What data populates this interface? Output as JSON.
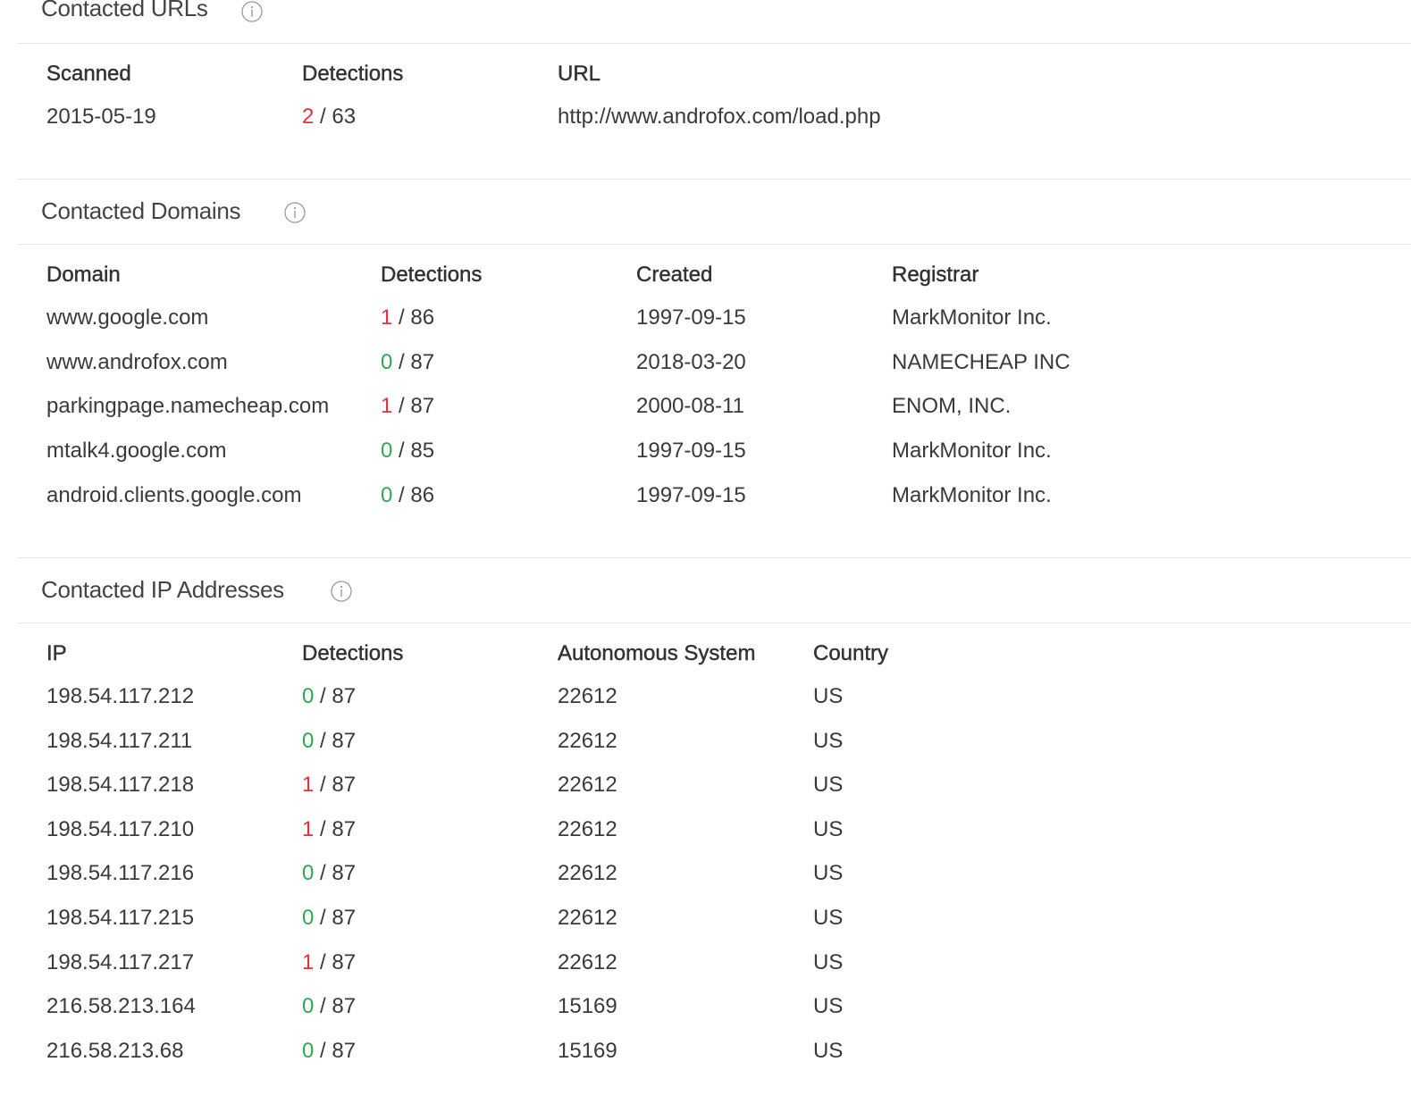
{
  "sections": {
    "urls": {
      "title": "Contacted URLs",
      "headers": [
        "Scanned",
        "Detections",
        "URL"
      ],
      "rows": [
        {
          "scanned": "2015-05-19",
          "det_pos": "2",
          "det_total": "63",
          "url": "http://www.androfox.com/load.php"
        }
      ]
    },
    "domains": {
      "title": "Contacted Domains",
      "headers": [
        "Domain",
        "Detections",
        "Created",
        "Registrar"
      ],
      "rows": [
        {
          "domain": "www.google.com",
          "det_pos": "1",
          "det_total": "86",
          "created": "1997-09-15",
          "registrar": "MarkMonitor Inc."
        },
        {
          "domain": "www.androfox.com",
          "det_pos": "0",
          "det_total": "87",
          "created": "2018-03-20",
          "registrar": "NAMECHEAP INC"
        },
        {
          "domain": "parkingpage.namecheap.com",
          "det_pos": "1",
          "det_total": "87",
          "created": "2000-08-11",
          "registrar": "ENOM, INC."
        },
        {
          "domain": "mtalk4.google.com",
          "det_pos": "0",
          "det_total": "85",
          "created": "1997-09-15",
          "registrar": "MarkMonitor Inc."
        },
        {
          "domain": "android.clients.google.com",
          "det_pos": "0",
          "det_total": "86",
          "created": "1997-09-15",
          "registrar": "MarkMonitor Inc."
        }
      ]
    },
    "ips": {
      "title": "Contacted IP Addresses",
      "headers": [
        "IP",
        "Detections",
        "Autonomous System",
        "Country"
      ],
      "rows": [
        {
          "ip": "198.54.117.212",
          "det_pos": "0",
          "det_total": "87",
          "asn": "22612",
          "country": "US"
        },
        {
          "ip": "198.54.117.211",
          "det_pos": "0",
          "det_total": "87",
          "asn": "22612",
          "country": "US"
        },
        {
          "ip": "198.54.117.218",
          "det_pos": "1",
          "det_total": "87",
          "asn": "22612",
          "country": "US"
        },
        {
          "ip": "198.54.117.210",
          "det_pos": "1",
          "det_total": "87",
          "asn": "22612",
          "country": "US"
        },
        {
          "ip": "198.54.117.216",
          "det_pos": "0",
          "det_total": "87",
          "asn": "22612",
          "country": "US"
        },
        {
          "ip": "198.54.117.215",
          "det_pos": "0",
          "det_total": "87",
          "asn": "22612",
          "country": "US"
        },
        {
          "ip": "198.54.117.217",
          "det_pos": "1",
          "det_total": "87",
          "asn": "22612",
          "country": "US"
        },
        {
          "ip": "216.58.213.164",
          "det_pos": "0",
          "det_total": "87",
          "asn": "15169",
          "country": "US"
        },
        {
          "ip": "216.58.213.68",
          "det_pos": "0",
          "det_total": "87",
          "asn": "15169",
          "country": "US"
        }
      ]
    }
  },
  "colors": {
    "detection_positive": "#e0323c",
    "detection_zero": "#2fa854"
  },
  "icons": {
    "info": "info-circle-icon"
  }
}
